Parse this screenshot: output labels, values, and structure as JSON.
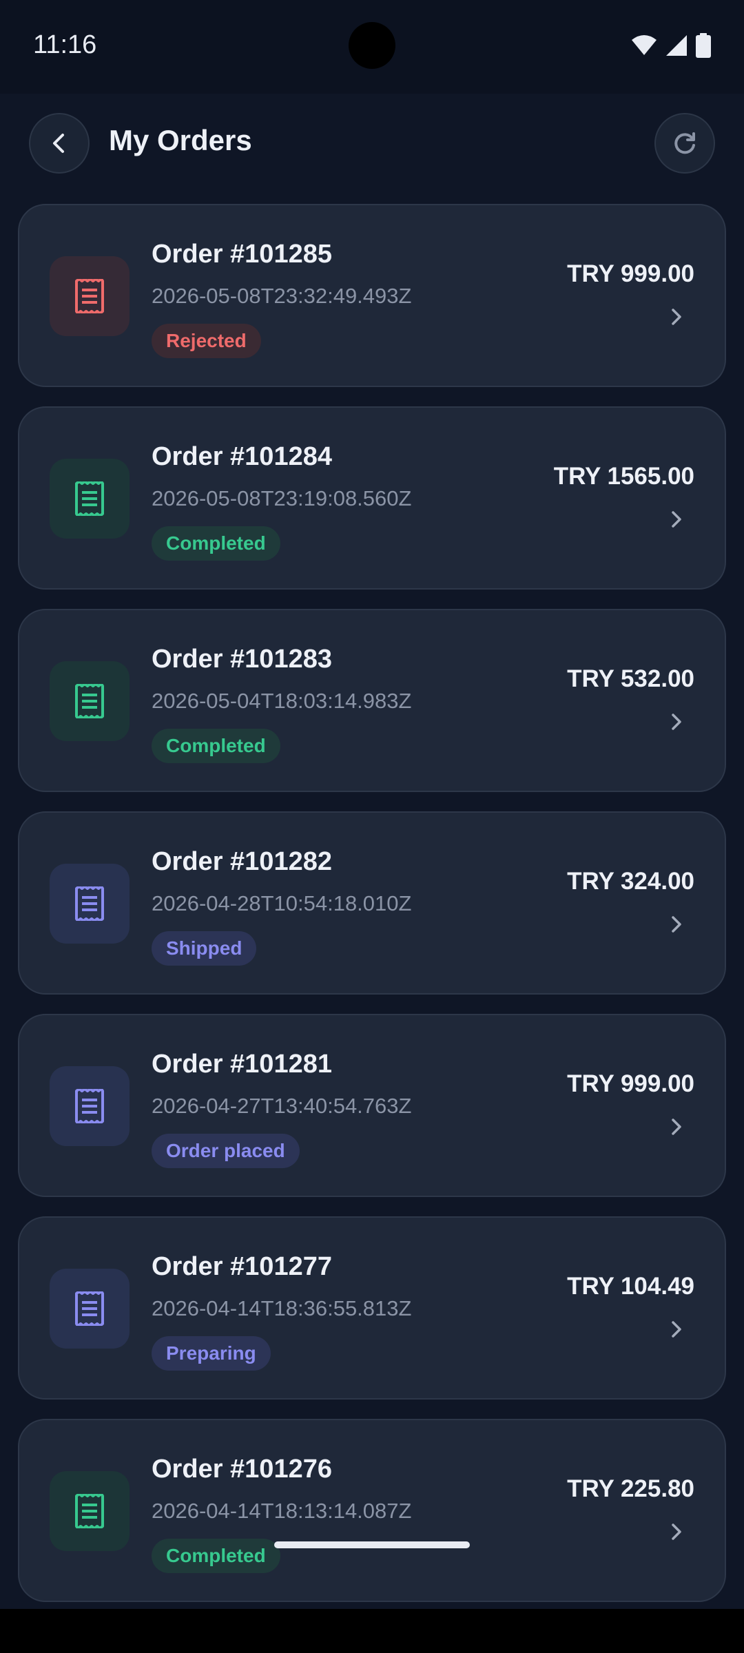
{
  "status_bar": {
    "time": "11:16",
    "icons": [
      "wifi-icon",
      "signal-icon",
      "battery-icon"
    ]
  },
  "header": {
    "title": "My Orders",
    "back_icon": "back-arrow-icon",
    "refresh_icon": "refresh-icon"
  },
  "status_colors": {
    "rejected": {
      "text": "#ef6b6b",
      "bg": "#3a2a33",
      "icon_bg": "#352a36"
    },
    "completed": {
      "text": "#37c98f",
      "bg": "#1f3a3a",
      "icon_bg": "#1c3537"
    },
    "info": {
      "text": "#8a8cf0",
      "bg": "#2c3456",
      "icon_bg": "#283250"
    }
  },
  "orders": [
    {
      "title": "Order #101285",
      "date": "2026-05-08T23:32:49.493Z",
      "status": "Rejected",
      "status_type": "rejected",
      "amount": "TRY 999.00",
      "icon": "receipt-icon"
    },
    {
      "title": "Order #101284",
      "date": "2026-05-08T23:19:08.560Z",
      "status": "Completed",
      "status_type": "completed",
      "amount": "TRY 1565.00",
      "icon": "receipt-icon"
    },
    {
      "title": "Order #101283",
      "date": "2026-05-04T18:03:14.983Z",
      "status": "Completed",
      "status_type": "completed",
      "amount": "TRY 532.00",
      "icon": "receipt-icon"
    },
    {
      "title": "Order #101282",
      "date": "2026-04-28T10:54:18.010Z",
      "status": "Shipped",
      "status_type": "info",
      "amount": "TRY 324.00",
      "icon": "receipt-icon"
    },
    {
      "title": "Order #101281",
      "date": "2026-04-27T13:40:54.763Z",
      "status": "Order placed",
      "status_type": "info",
      "amount": "TRY 999.00",
      "icon": "receipt-icon"
    },
    {
      "title": "Order #101277",
      "date": "2026-04-14T18:36:55.813Z",
      "status": "Preparing",
      "status_type": "info",
      "amount": "TRY 104.49",
      "icon": "receipt-icon"
    },
    {
      "title": "Order #101276",
      "date": "2026-04-14T18:13:14.087Z",
      "status": "Completed",
      "status_type": "completed",
      "amount": "TRY 225.80",
      "icon": "receipt-icon"
    }
  ]
}
